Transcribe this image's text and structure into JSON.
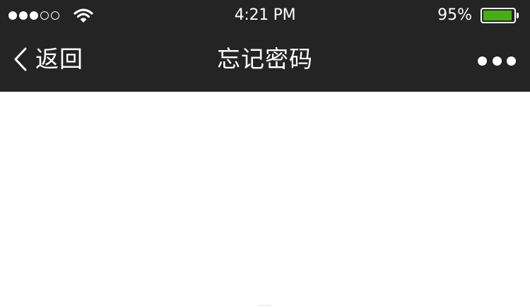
{
  "status_bar": {
    "signal": {
      "filled_dots": 3,
      "total_dots": 5
    },
    "wifi_icon": "wifi-icon",
    "time": "4:21 PM",
    "battery_percent": "95%",
    "battery_level": 0.95,
    "battery_color": "#45b014"
  },
  "nav_bar": {
    "back_icon": "chevron-left-icon",
    "back_label": "返回",
    "title": "忘记密码",
    "more_icon": "more-dots-icon",
    "background": "#242424"
  }
}
